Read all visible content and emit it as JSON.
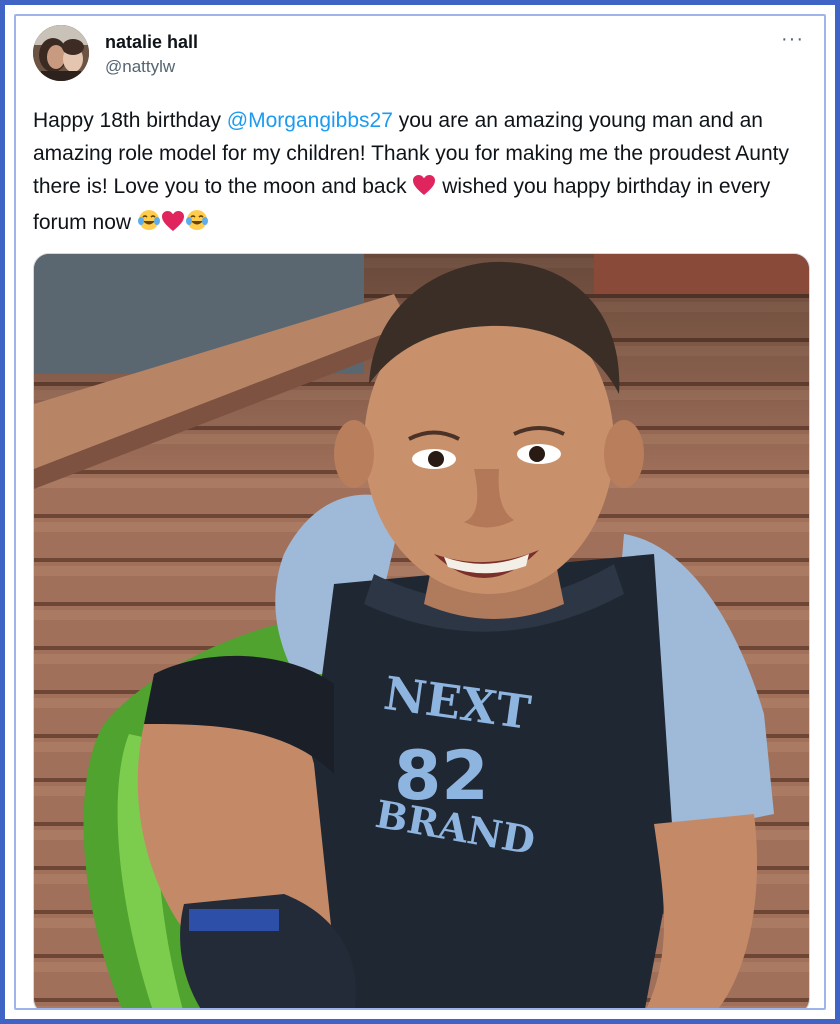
{
  "tweet": {
    "author": {
      "display_name": "natalie hall",
      "handle": "@nattylw"
    },
    "text": {
      "part1": "Happy 18th birthday ",
      "mention": "@Morgangibbs27",
      "part2": " you are an amazing young man and an amazing role model for my children! Thank you for making me the proudest Aunty there is! Love you to the moon and back ",
      "part3": " wished you happy birthday in every forum now "
    },
    "emojis": [
      "red-heart",
      "face-with-tears-of-joy",
      "red-heart",
      "face-with-tears-of-joy"
    ],
    "more_menu": "···",
    "photo": {
      "shirt_text_top": "NEXT",
      "shirt_number": "82",
      "shirt_text_bottom": "BRAND"
    }
  },
  "colors": {
    "frame_border": "#3f64c6",
    "mention": "#1d9bf0",
    "heart": "#e0245e"
  }
}
